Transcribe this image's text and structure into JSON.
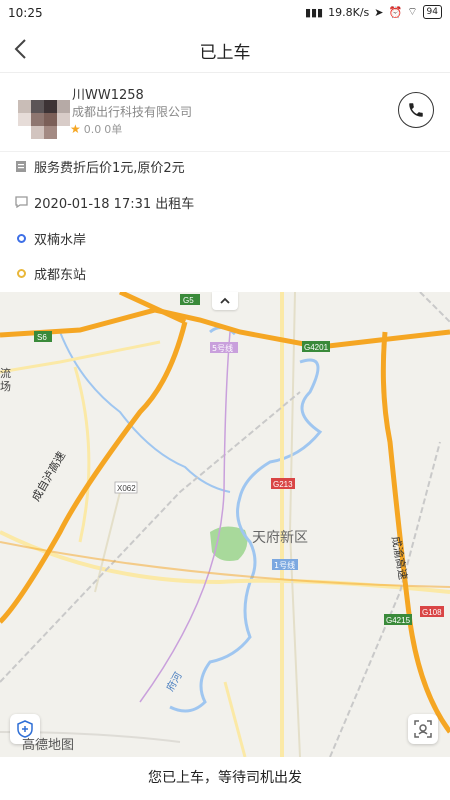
{
  "status_bar": {
    "time": "10:25",
    "network_speed": "19.8K/s",
    "icons": [
      "signal-icon",
      "location-arrow-icon",
      "alarm-icon",
      "wifi-icon"
    ],
    "battery": "94"
  },
  "header": {
    "title": "已上车",
    "back_icon": "chevron-left-icon"
  },
  "driver": {
    "plate": "川WW1258",
    "company": "成都出行科技有限公司",
    "rating": "0.0",
    "orders": "0单",
    "call_icon": "phone-icon"
  },
  "trip": {
    "fare_note": "服务费折后价1元,原价2元",
    "time_and_type": "2020-01-18 17:31 出租车",
    "origin": "双楠水岸",
    "destination": "成都东站"
  },
  "map": {
    "district_label": "天府新区",
    "road_labels": {
      "g5": "G5",
      "s6": "S6",
      "g4201": "G4201",
      "line5": "5号线",
      "x062": "X062",
      "g213": "G213",
      "line1": "1号线",
      "g4215": "G4215",
      "g108": "G108"
    },
    "road_names": {
      "west_highway": "成自泸高速",
      "east_highway": "成渝高速",
      "river": "府河",
      "left_edge": "流\n场"
    },
    "brand": "高德地图",
    "colors": {
      "expressway": "#f5a623",
      "road": "#fbe9a6",
      "water": "#9fc6f0",
      "green": "#a8d99b"
    }
  },
  "footer": {
    "status_message": "您已上车，等待司机出发"
  }
}
